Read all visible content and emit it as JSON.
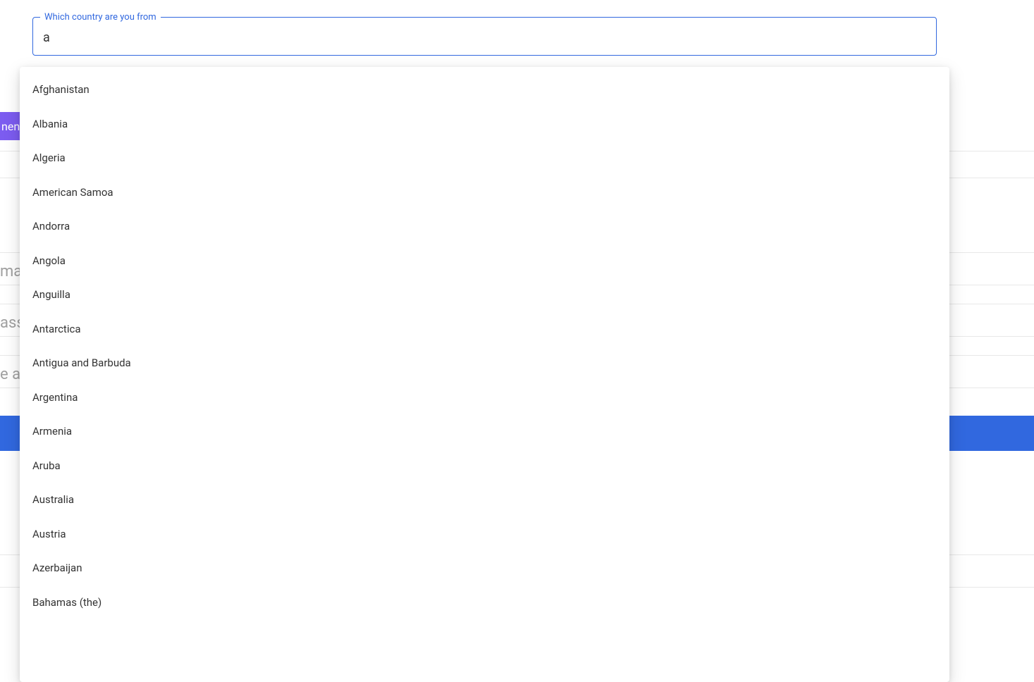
{
  "combobox": {
    "label": "Which country are you from",
    "value": "a"
  },
  "options": [
    "Afghanistan",
    "Albania",
    "Algeria",
    "American Samoa",
    "Andorra",
    "Angola",
    "Anguilla",
    "Antarctica",
    "Antigua and Barbuda",
    "Argentina",
    "Armenia",
    "Aruba",
    "Australia",
    "Austria",
    "Azerbaijan",
    "Bahamas (the)"
  ],
  "background": {
    "tab_fragment": "nen",
    "field_ma": "ma",
    "field_ass": "ass",
    "field_ea": "e a"
  }
}
